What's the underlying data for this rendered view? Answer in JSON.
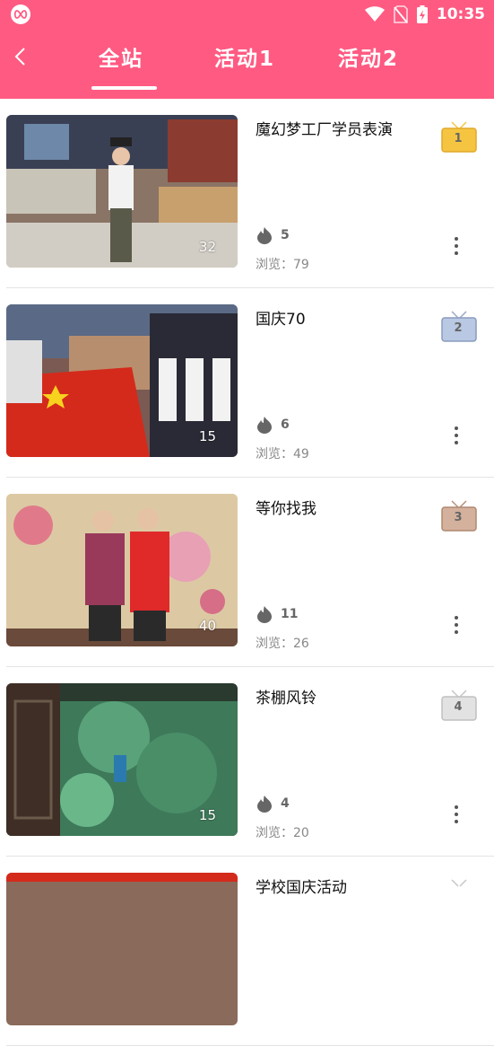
{
  "status_bar": {
    "time": "10:35"
  },
  "header": {
    "tabs": [
      {
        "label": "全站",
        "active": true
      },
      {
        "label": "活动1",
        "active": false
      },
      {
        "label": "活动2",
        "active": false
      }
    ]
  },
  "colors": {
    "accent": "#ff5a82",
    "rank1": "#f5c542",
    "rank2": "#b9c8e3",
    "rank3": "#d4b19d",
    "rank4": "#e2e2e2"
  },
  "items": [
    {
      "title": "魔幻梦工厂学员表演",
      "thumb_count": "32",
      "likes": "5",
      "views": "浏览：79",
      "rank": "1"
    },
    {
      "title": "国庆70",
      "thumb_count": "15",
      "likes": "6",
      "views": "浏览：49",
      "rank": "2"
    },
    {
      "title": "等你找我",
      "thumb_count": "40",
      "likes": "11",
      "views": "浏览：26",
      "rank": "3"
    },
    {
      "title": "茶棚风铃",
      "thumb_count": "15",
      "likes": "4",
      "views": "浏览：20",
      "rank": "4"
    },
    {
      "title": "学校国庆活动",
      "thumb_count": "",
      "likes": "",
      "views": "",
      "rank": ""
    }
  ]
}
